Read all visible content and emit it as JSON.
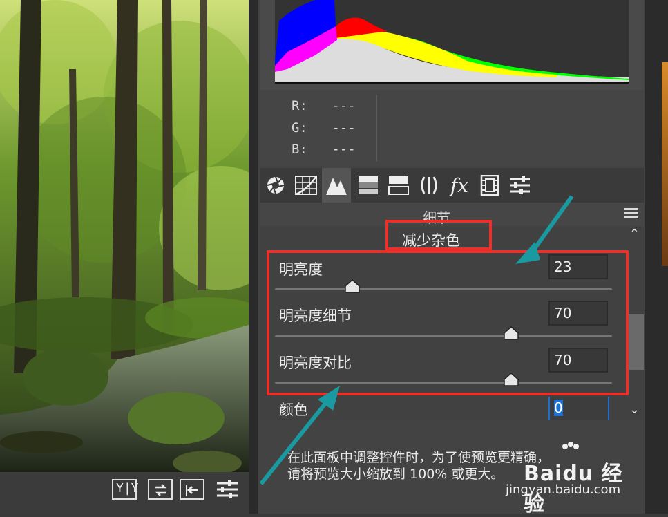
{
  "histogram": {
    "colors": [
      "#0000ff",
      "#ff00ff",
      "#ff0000",
      "#ffff00",
      "#00ff00",
      "#dddddd"
    ]
  },
  "readout": {
    "r_label": "R:",
    "r_value": "---",
    "g_label": "G:",
    "g_value": "---",
    "b_label": "B:",
    "b_value": "---"
  },
  "tabs": [
    {
      "icon": "aperture-icon"
    },
    {
      "icon": "tone-curve-icon"
    },
    {
      "icon": "detail-mountain-icon",
      "active": true
    },
    {
      "icon": "hsl-icon"
    },
    {
      "icon": "split-toning-icon"
    },
    {
      "icon": "lens-correction-icon"
    },
    {
      "icon": "fx-icon",
      "text": "fx"
    },
    {
      "icon": "camera-calibration-icon"
    },
    {
      "icon": "presets-sliders-icon"
    }
  ],
  "section_title": "细节",
  "noise_reduction": {
    "heading": "减少杂色",
    "luminance": {
      "label": "明亮度",
      "value": "23",
      "level": 23
    },
    "luminance_detail": {
      "label": "明亮度细节",
      "value": "70",
      "level": 70
    },
    "luminance_contrast": {
      "label": "明亮度对比",
      "value": "70",
      "level": 70
    },
    "color": {
      "label": "颜色",
      "value": "0"
    }
  },
  "hint": {
    "line1": "在此面板中调整控件时，为了使预览更精确，",
    "line2": "请将预览大小缩放到 100% 或更大。"
  },
  "watermark": {
    "main": "Baidu 经验",
    "sub": "jingyan.baidu.com"
  },
  "accent": {
    "red_box": "#e8312b",
    "arrow": "#1a9aa0",
    "selection": "#1f6fd0"
  }
}
